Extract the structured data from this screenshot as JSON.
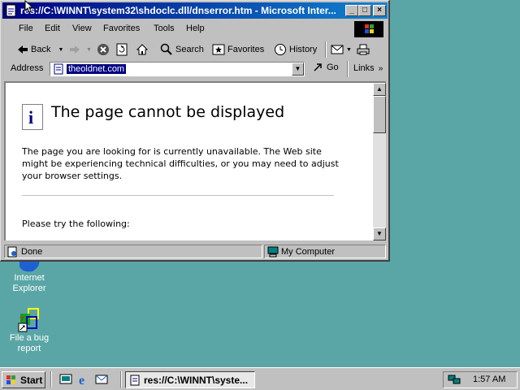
{
  "window": {
    "title": "res://C:\\WINNT\\system32\\shdoclc.dll/dnserror.htm - Microsoft Inter..."
  },
  "menu": [
    "File",
    "Edit",
    "View",
    "Favorites",
    "Tools",
    "Help"
  ],
  "toolbar": {
    "back": "Back",
    "search": "Search",
    "favorites": "Favorites",
    "history": "History"
  },
  "address": {
    "label": "Address",
    "value": "theoldnet.com",
    "go": "Go",
    "links": "Links"
  },
  "page": {
    "heading": "The page cannot be displayed",
    "body": "The page you are looking for is currently unavailable. The Web site might be experiencing technical difficulties, or you may need to adjust your browser settings.",
    "try": "Please try the following:"
  },
  "status": {
    "text": "Done",
    "zone": "My Computer"
  },
  "desktop": {
    "icons": [
      {
        "label": "Internet Explorer"
      },
      {
        "label": "File a bug report"
      }
    ]
  },
  "taskbar": {
    "start": "Start",
    "task": "res://C:\\WINNT\\syste...",
    "clock": "1:57 AM"
  }
}
